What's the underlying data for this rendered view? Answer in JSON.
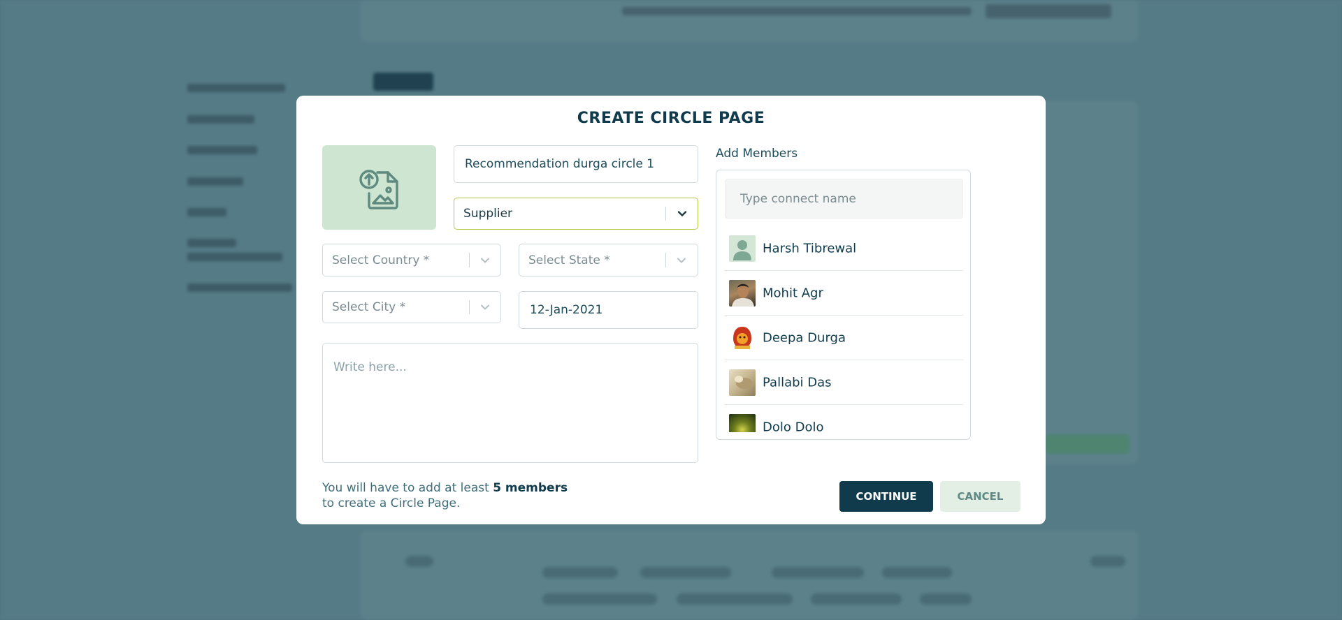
{
  "colors": {
    "primary": "#0f3b4c",
    "upload_bg": "#cde5d1",
    "select_focus_border": "#b5c84a",
    "cancel_bg": "#e3efe5",
    "overlay": "#4e7480"
  },
  "modal": {
    "title": "CREATE CIRCLE PAGE",
    "upload_icon": "image-upload-icon",
    "circle_name": "Recommendation durga circle 1",
    "circle_type": "Supplier",
    "country_placeholder": "Select Country *",
    "state_placeholder": "Select State *",
    "city_placeholder": "Select City *",
    "date": "12-Jan-2021",
    "description_placeholder": "Write here...",
    "note_prefix": "You will have to add at least ",
    "note_bold": "5 members",
    "note_suffix": "to create a Circle Page.",
    "continue_label": "CONTINUE",
    "cancel_label": "CANCEL"
  },
  "members": {
    "label": "Add Members",
    "search_placeholder": "Type connect name",
    "items": [
      {
        "name": "Harsh Tibrewal",
        "avatar": "default-person-icon"
      },
      {
        "name": "Mohit Agr",
        "avatar": "photo"
      },
      {
        "name": "Deepa Durga",
        "avatar": "photo"
      },
      {
        "name": "Pallabi Das",
        "avatar": "photo"
      },
      {
        "name": "Dolo Dolo",
        "avatar": "photo"
      }
    ]
  }
}
